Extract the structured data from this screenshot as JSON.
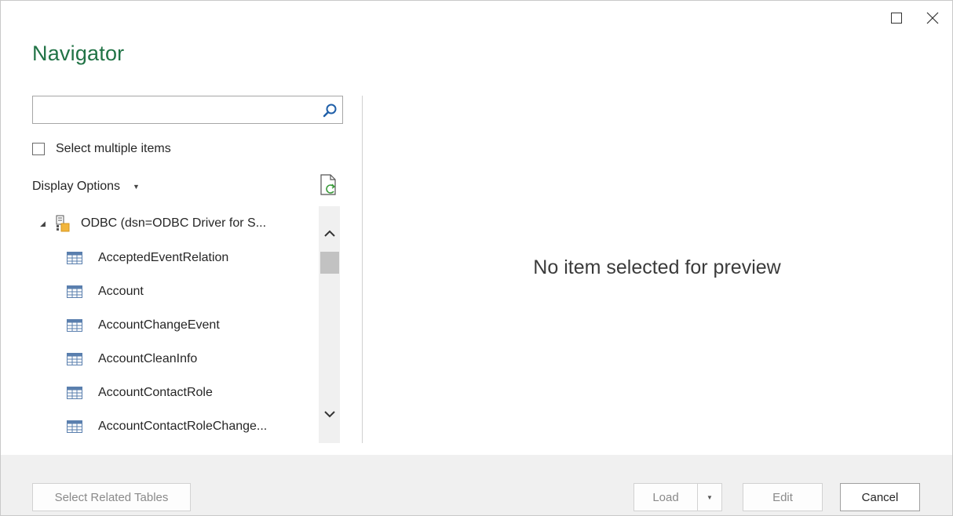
{
  "window": {
    "title": "Navigator",
    "maximize_icon": "maximize-icon",
    "close_icon": "close-icon"
  },
  "search": {
    "value": "",
    "placeholder": "",
    "icon": "search-icon"
  },
  "select_multiple": {
    "label": "Select multiple items",
    "checked": false
  },
  "display_options": {
    "label": "Display Options",
    "caret": "▼",
    "refresh_icon": "refresh-document-icon"
  },
  "tree": {
    "root": {
      "expander": "◢",
      "label": "ODBC (dsn=ODBC Driver for S..."
    },
    "items": [
      {
        "label": "AcceptedEventRelation"
      },
      {
        "label": "Account"
      },
      {
        "label": "AccountChangeEvent"
      },
      {
        "label": "AccountCleanInfo"
      },
      {
        "label": "AccountContactRole"
      },
      {
        "label": "AccountContactRoleChange..."
      }
    ]
  },
  "preview": {
    "message": "No item selected for preview"
  },
  "footer": {
    "select_related_label": "Select Related Tables",
    "load_label": "Load",
    "load_caret": "▼",
    "edit_label": "Edit",
    "cancel_label": "Cancel"
  },
  "colors": {
    "title": "#217346",
    "footer_bg": "#f0f0f0",
    "search_icon": "#1f5fa8"
  }
}
